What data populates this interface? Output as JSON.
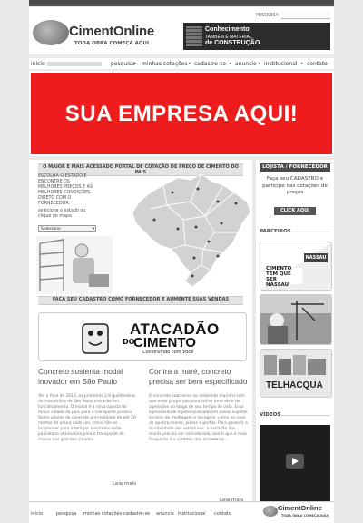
{
  "header": {
    "logo_name": "CimentOnline",
    "logo_tagline": "TODA OBRA COMEÇA AQUI",
    "search_label": "PESQUISA",
    "banner": {
      "line1": "Conhecimento",
      "line2": "TAMBÉM É MATERIAL",
      "line3": "de CONSTRUÇÃO"
    }
  },
  "nav": {
    "items": [
      "início",
      "pesquisa",
      "minhas cotações",
      "cadastre-se",
      "anuncie",
      "institucional",
      "contato"
    ]
  },
  "ad": {
    "text": "SUA EMPRESA AQUI!",
    "color": "#ee1c1c"
  },
  "map_section": {
    "title": "O MAIOR E MAIS ACESSADO PORTAL DE COTAÇÃO DE PREÇO DE CIMENTO DO PAÍS",
    "intro": "ESCOLHA O ESTADO E ENCONTRE OS MELHORES PREÇOS E AS MELHORES CONDIÇÕES, DIRETO COM O FORNECEDOR.",
    "select_label": "selecione o estado ou clique no mapa",
    "select_value": "Selecione"
  },
  "cadastro": {
    "title": "FAÇA SEU CADASTRO COMO FORNECEDOR E AUMENTE SUAS VENDAS"
  },
  "atacadao": {
    "line1": "ATACADÃO",
    "line2_prefix": "DO",
    "line2": "CIMENTO",
    "tagline": "Construindo com Você"
  },
  "articles": [
    {
      "title": "Concreto sustenta modal inovador em São Paulo",
      "body": "Até o final de 2013, os primeiros 2,9 quilômetros do monotrilho de São Paulo entrarão em funcionamento. O modal é a nova aposta do maior cidade do país para o transporte público. Sobre pilares de concreto pré-moldado de até 20 metros de altura cada um, trens irão se locomover para interligar a extremo leste paulistano alternativa para o transporte de massa nas grandes cidades.",
      "more": "Leia mais"
    },
    {
      "title": "Contra a maré, concreto precisa ser bem especificado",
      "body": "O concreto submerso no ambiente marinho tem que estar preparado para sofrer uma série de agressões ao longo de seu tempo de vida. Essa agressividade é potencializada em zonas sujeitas à ciclos de molhagem e secagem, como no caso de quebra-mares, píeres e portos. Para garantir a durabilidade das estruturas, a variação das marés precisa ser considerada, assim que é mais frequente é o controle das armaduras...",
      "more": "Leia mais"
    }
  ],
  "sidebar": {
    "lojista_tab": "LOJISTA / FORNECEDOR",
    "lojista_text": "Faça seu CADASTRO e participe das cotações de preços",
    "cta": "CLICK AQUI",
    "parceiros_title": "PARCEIROS",
    "nassau_text": "CIMENTO TEM QUE SER NASSAU",
    "nassau_brand": "NASSAU",
    "telhacqua": "TELHACQUA",
    "videos_title": "VÍDEOS"
  },
  "footer": {
    "items": [
      "início",
      "pesquisa",
      "minhas cotações",
      "cadastre-se",
      "anuncie",
      "institucional",
      "contato"
    ],
    "logo_name": "CimentOnline",
    "logo_tagline": "TODA OBRA COMEÇA AQUI"
  }
}
